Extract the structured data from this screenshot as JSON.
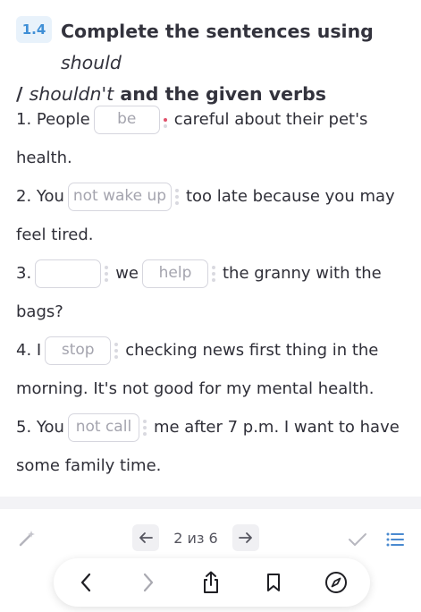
{
  "header": {
    "number": "1.4",
    "title_part1": "Complete the sentences using ",
    "title_should": "should",
    "title_slash": "/ ",
    "title_shouldnt": "shouldn't",
    "title_part2": " and the given verbs"
  },
  "sentences": [
    {
      "num": "1.",
      "before": "People",
      "gap": "be",
      "after": "careful about their pet's",
      "cont": "health."
    },
    {
      "num": "2.",
      "before": "You",
      "gap": "not wake up",
      "after": "too late because you may",
      "cont": "feel tired."
    },
    {
      "num": "3.",
      "gap1": "",
      "mid": "we",
      "gap2": "help",
      "after": "the granny with the",
      "cont": "bags?"
    },
    {
      "num": "4.",
      "before": "I",
      "gap": "stop",
      "after": "checking news first thing in the",
      "cont": "morning. It's not good for my mental health."
    },
    {
      "num": "5.",
      "before": "You",
      "gap": "not call",
      "after": "me after 7 p.m. I want to have",
      "cont": "some family time."
    }
  ],
  "toolbar": {
    "page_indicator": "2 из 6",
    "icons": [
      "magic-wand-icon",
      "arrow-left-icon",
      "arrow-right-icon",
      "check-icon",
      "list-icon"
    ]
  },
  "browser_bar": {
    "icons": [
      "back-icon",
      "forward-icon",
      "share-icon",
      "bookmark-icon",
      "compass-icon"
    ]
  },
  "colors": {
    "accent": "#3f8fd6",
    "badge_bg": "#e8f2fb",
    "error_dot": "#e0506a"
  }
}
